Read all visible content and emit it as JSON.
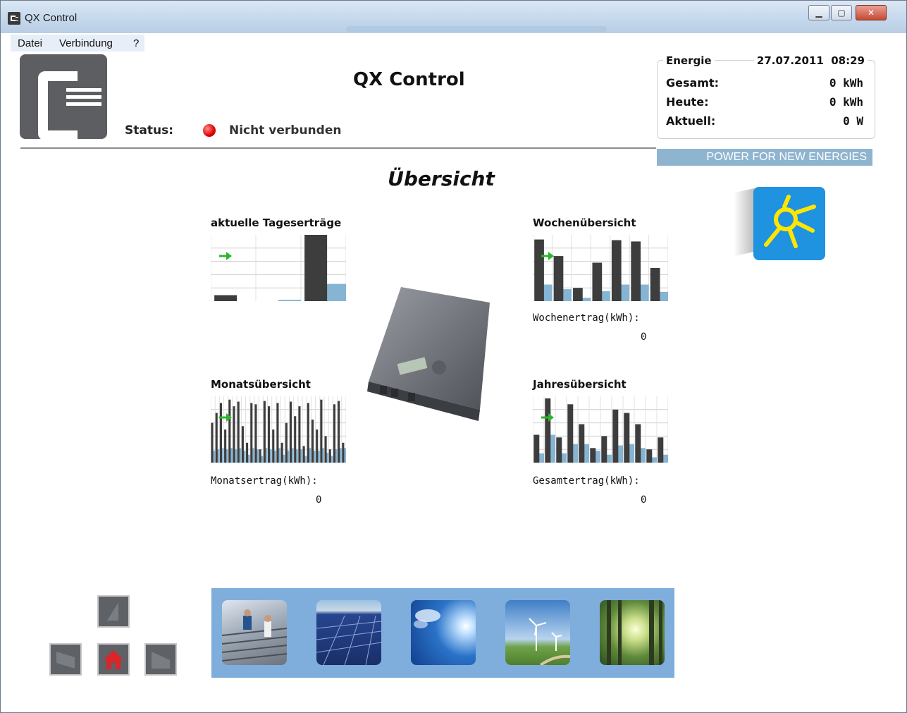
{
  "window": {
    "title": "QX Control"
  },
  "menu": {
    "items": [
      "Datei",
      "Verbindung",
      "?"
    ]
  },
  "header": {
    "app_title": "QX Control",
    "status_label": "Status:",
    "status_text": "Nicht verbunden",
    "status_color": "#e00000",
    "slogan": "POWER FOR NEW ENERGIES"
  },
  "energy": {
    "caption": "Energie",
    "datetime": "27.07.2011  08:29",
    "rows": [
      {
        "label": "Gesamt:",
        "value": "0 kWh"
      },
      {
        "label": "Heute:",
        "value": "0 kWh"
      },
      {
        "label": "Aktuell:",
        "value": "0 W"
      }
    ]
  },
  "main": {
    "heading": "Übersicht",
    "panels": {
      "daily": {
        "title": "aktuelle Tageserträge"
      },
      "weekly": {
        "title": "Wochenübersicht",
        "note_label": "Wochenertrag(kWh):",
        "note_value": "0"
      },
      "monthly": {
        "title": "Monatsübersicht",
        "note_label": "Monatsertrag(kWh):",
        "note_value": "0"
      },
      "yearly": {
        "title": "Jahresübersicht",
        "note_label": "Gesamtertrag(kWh):",
        "note_value": "0"
      }
    }
  },
  "colors": {
    "bar_dark": "#3d3d3d",
    "bar_light": "#86b4d3",
    "arrow": "#2db52d",
    "strip": "#7faedc"
  },
  "chart_data": [
    {
      "type": "bar",
      "title": "aktuelle Tageserträge",
      "series": [
        {
          "values": [
            0.09,
            0.0,
            1.0
          ]
        },
        {
          "values": [
            0.0,
            0.02,
            0.26
          ]
        }
      ]
    },
    {
      "type": "bar",
      "title": "Wochenübersicht",
      "series": [
        {
          "values": [
            0.93,
            0.68,
            0.2,
            0.58,
            0.92,
            0.9,
            0.5
          ]
        },
        {
          "values": [
            0.25,
            0.18,
            0.05,
            0.15,
            0.25,
            0.25,
            0.14
          ]
        }
      ]
    },
    {
      "type": "bar",
      "title": "Monatsübersicht",
      "series": [
        {
          "values": [
            0.6,
            0.75,
            0.9,
            0.5,
            0.95,
            0.85,
            0.92,
            0.55,
            0.3,
            0.9,
            0.88,
            0.2,
            0.93,
            0.85,
            0.5,
            0.9,
            0.3,
            0.6,
            0.92,
            0.7,
            0.85,
            0.25,
            0.9,
            0.65,
            0.5,
            0.95,
            0.4,
            0.2,
            0.88,
            0.93,
            0.3
          ]
        },
        {
          "values": [
            0.18,
            0.2,
            0.22,
            0.2,
            0.22,
            0.2,
            0.22,
            0.18,
            0.12,
            0.22,
            0.2,
            0.1,
            0.22,
            0.2,
            0.18,
            0.22,
            0.12,
            0.18,
            0.22,
            0.2,
            0.2,
            0.1,
            0.22,
            0.18,
            0.18,
            0.22,
            0.15,
            0.1,
            0.2,
            0.22,
            0.22
          ]
        }
      ]
    },
    {
      "type": "bar",
      "title": "Jahresübersicht",
      "series": [
        {
          "values": [
            0.42,
            0.97,
            0.38,
            0.88,
            0.58,
            0.22,
            0.4,
            0.8,
            0.75,
            0.58,
            0.2,
            0.38
          ]
        },
        {
          "values": [
            0.14,
            0.42,
            0.14,
            0.28,
            0.28,
            0.18,
            0.12,
            0.26,
            0.28,
            0.22,
            0.08,
            0.12
          ]
        }
      ]
    }
  ],
  "nav": {
    "up": "up-icon",
    "left": "left-icon",
    "home": "home-icon",
    "right": "right-icon"
  },
  "thumbnails": [
    "solar-installers",
    "solar-panels",
    "blue-sky",
    "wind-turbines",
    "sunlit-forest"
  ]
}
